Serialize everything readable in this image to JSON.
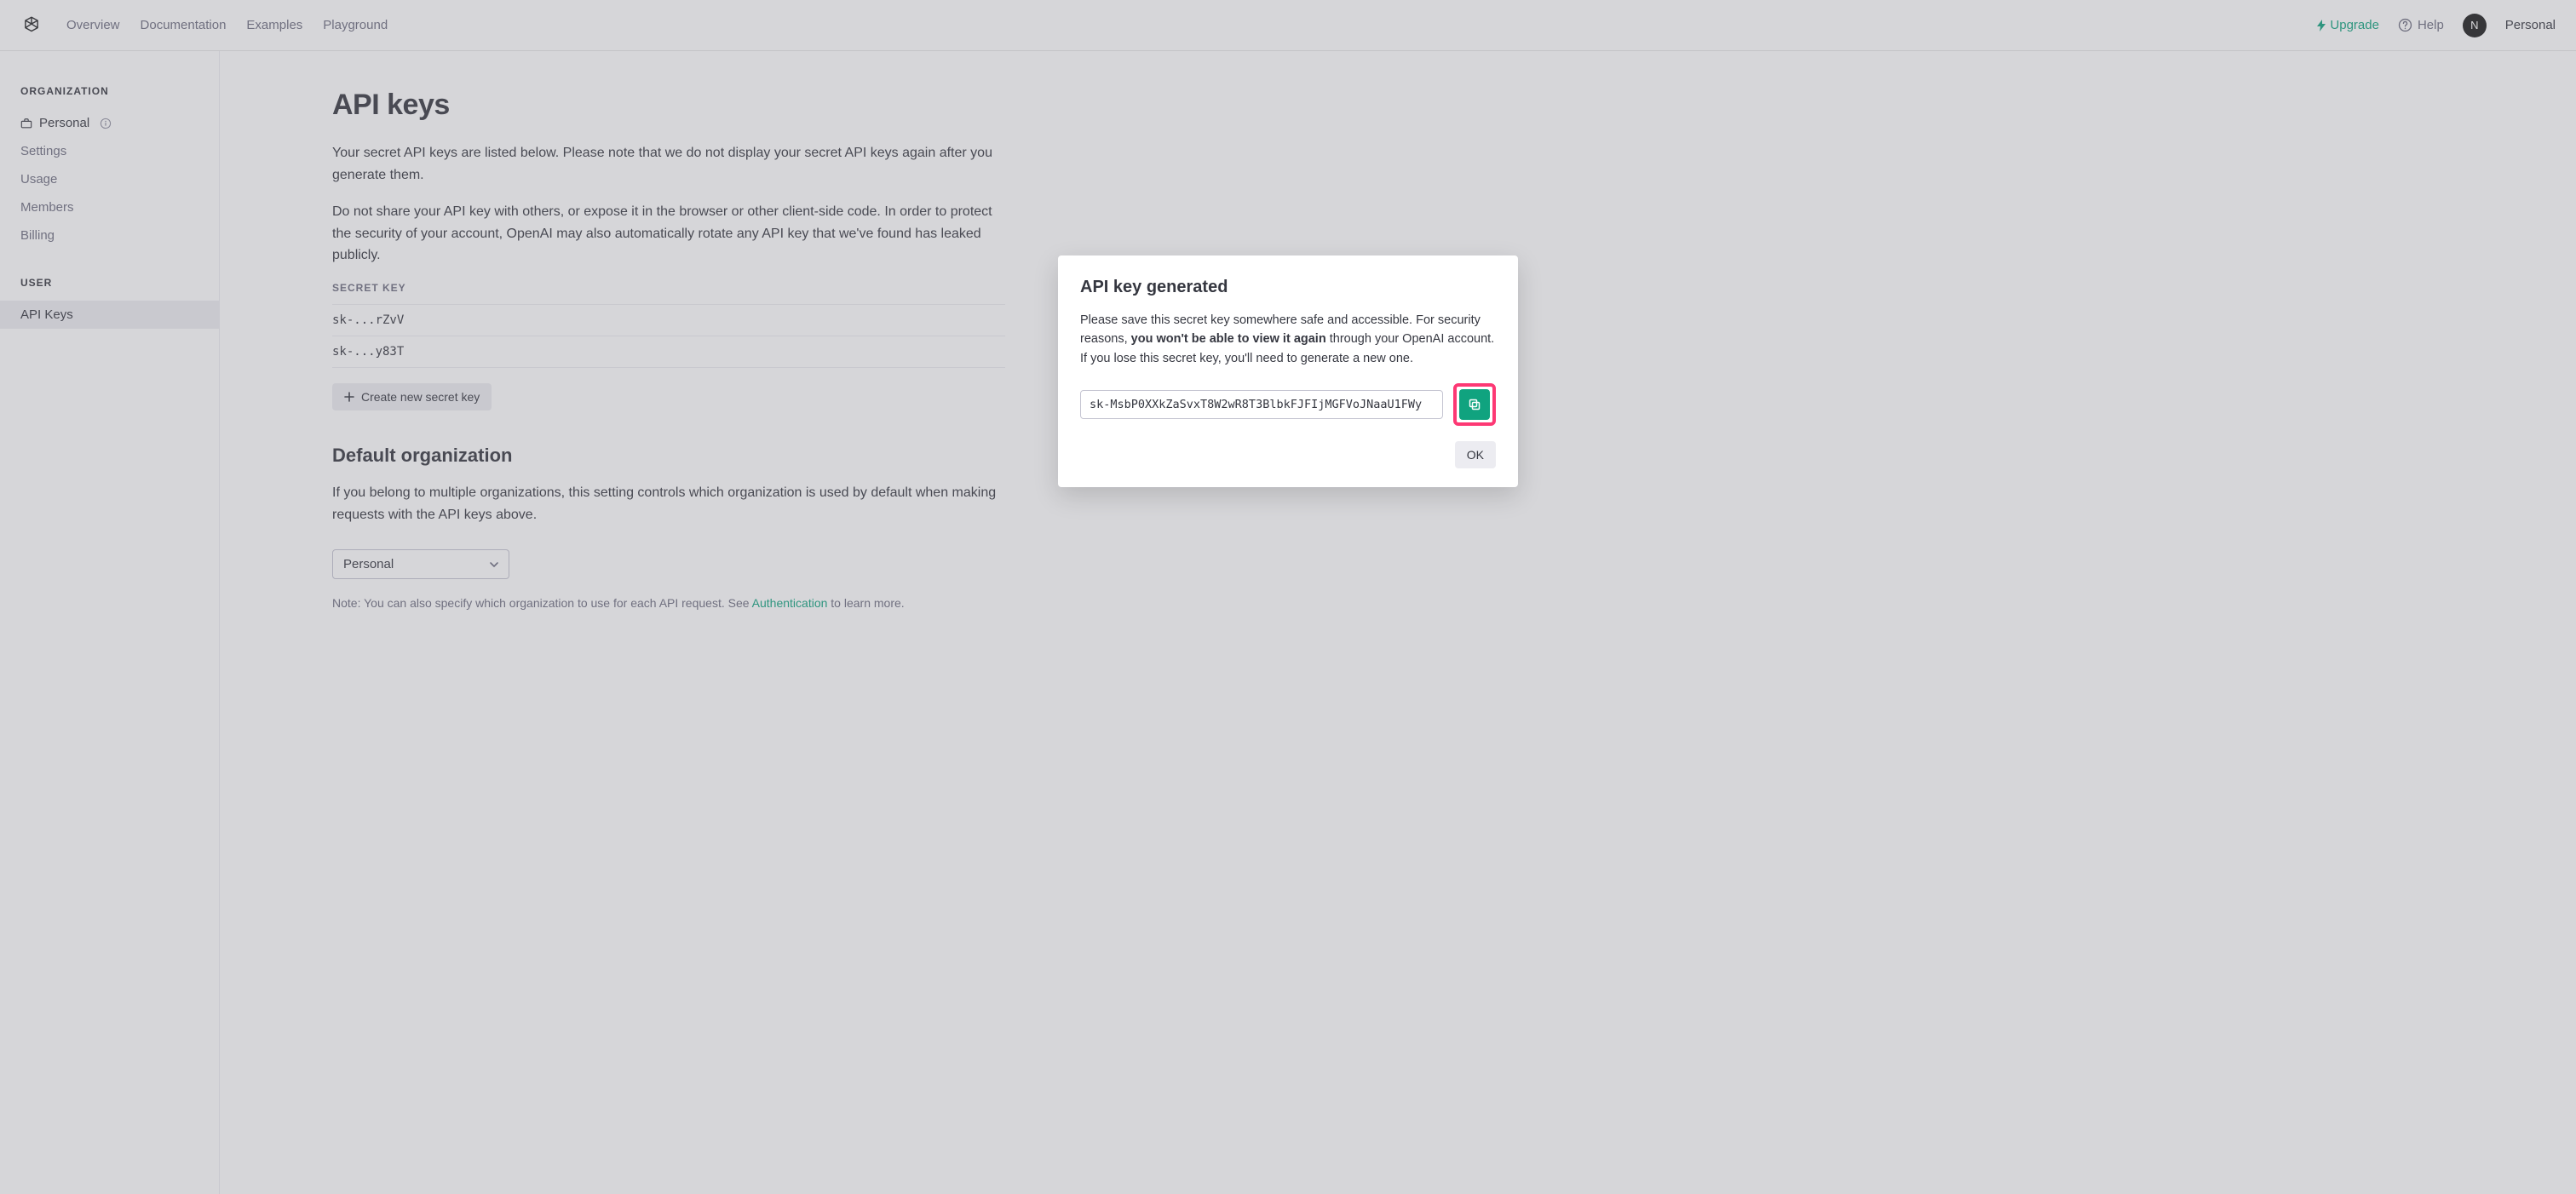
{
  "nav": {
    "links": [
      "Overview",
      "Documentation",
      "Examples",
      "Playground"
    ],
    "upgrade": "Upgrade",
    "help": "Help",
    "avatar_initial": "N",
    "username": "Personal"
  },
  "sidebar": {
    "org_header": "ORGANIZATION",
    "org_name": "Personal",
    "org_items": [
      "Settings",
      "Usage",
      "Members",
      "Billing"
    ],
    "user_header": "USER",
    "user_items": [
      "API Keys"
    ]
  },
  "main": {
    "title": "API keys",
    "para1": "Your secret API keys are listed below. Please note that we do not display your secret API keys again after you generate them.",
    "para2": "Do not share your API key with others, or expose it in the browser or other client-side code. In order to protect the security of your account, OpenAI may also automatically rotate any API key that we've found has leaked publicly.",
    "secret_key_label": "SECRET KEY",
    "keys": [
      "sk-...rZvV",
      "sk-...y83T"
    ],
    "create_button": "Create new secret key",
    "default_org_heading": "Default organization",
    "default_org_para": "If you belong to multiple organizations, this setting controls which organization is used by default when making requests with the API keys above.",
    "default_org_select": "Personal",
    "note_prefix": "Note: You can also specify which organization to use for each API request. See ",
    "note_link": "Authentication",
    "note_suffix": " to learn more."
  },
  "modal": {
    "title": "API key generated",
    "body_prefix": "Please save this secret key somewhere safe and accessible. For security reasons, ",
    "body_bold": "you won't be able to view it again",
    "body_suffix": " through your OpenAI account. If you lose this secret key, you'll need to generate a new one.",
    "key_value": "sk-MsbP0XXkZaSvxT8W2wR8T3BlbkFJFIjMGFVoJNaaU1FWy",
    "ok": "OK"
  }
}
